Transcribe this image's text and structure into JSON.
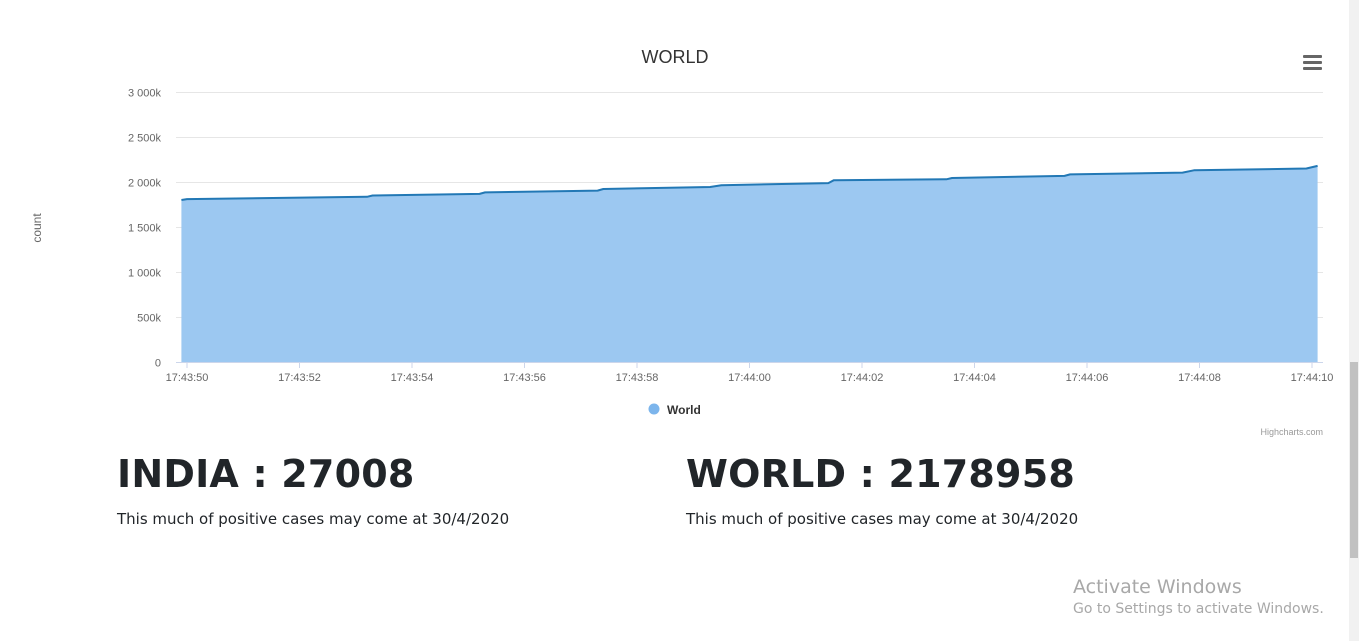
{
  "chart_data": {
    "type": "area",
    "title": "WORLD",
    "xlabel": "",
    "ylabel": "count",
    "x_ticks": [
      "17:43:50",
      "17:43:52",
      "17:43:54",
      "17:43:56",
      "17:43:58",
      "17:44:00",
      "17:44:02",
      "17:44:04",
      "17:44:06",
      "17:44:08",
      "17:44:10"
    ],
    "y_ticks": [
      "0",
      "500k",
      "1 000k",
      "1 500k",
      "2 000k",
      "2 500k",
      "3 000k"
    ],
    "ylim": [
      0,
      3000000
    ],
    "xlim_seconds_after_17_43_50": [
      0,
      20
    ],
    "series": [
      {
        "name": "World",
        "color": "#7cb5ec",
        "fill": "#9cc8f1",
        "line_color": "#2278b5",
        "points": [
          {
            "t": "17:43:49.9",
            "y": 1800000
          },
          {
            "t": "17:43:50.0",
            "y": 1810000
          },
          {
            "t": "17:43:53.2",
            "y": 1835000
          },
          {
            "t": "17:43:53.3",
            "y": 1850000
          },
          {
            "t": "17:43:55.2",
            "y": 1868000
          },
          {
            "t": "17:43:55.3",
            "y": 1885000
          },
          {
            "t": "17:43:57.3",
            "y": 1905000
          },
          {
            "t": "17:43:57.4",
            "y": 1922000
          },
          {
            "t": "17:43:59.3",
            "y": 1945000
          },
          {
            "t": "17:43:59.5",
            "y": 1965000
          },
          {
            "t": "17:44:01.4",
            "y": 1988000
          },
          {
            "t": "17:44:01.5",
            "y": 2020000
          },
          {
            "t": "17:44:03.5",
            "y": 2030000
          },
          {
            "t": "17:44:03.6",
            "y": 2045000
          },
          {
            "t": "17:44:05.6",
            "y": 2068000
          },
          {
            "t": "17:44:05.7",
            "y": 2085000
          },
          {
            "t": "17:44:07.7",
            "y": 2105000
          },
          {
            "t": "17:44:07.9",
            "y": 2130000
          },
          {
            "t": "17:44:09.9",
            "y": 2150000
          },
          {
            "t": "17:44:10.1",
            "y": 2178958
          }
        ]
      }
    ],
    "legend": "bottom-center",
    "grid": true,
    "credits": "Highcharts.com"
  },
  "stats": [
    {
      "title": "INDIA : 27008",
      "note": "This much of positive cases may come at 30/4/2020"
    },
    {
      "title": "WORLD : 2178958",
      "note": "This much of positive cases may come at 30/4/2020"
    }
  ],
  "watermark": {
    "line1": "Activate Windows",
    "line2": "Go to Settings to activate Windows."
  },
  "icons": {
    "menu": "hamburger-menu-icon"
  }
}
